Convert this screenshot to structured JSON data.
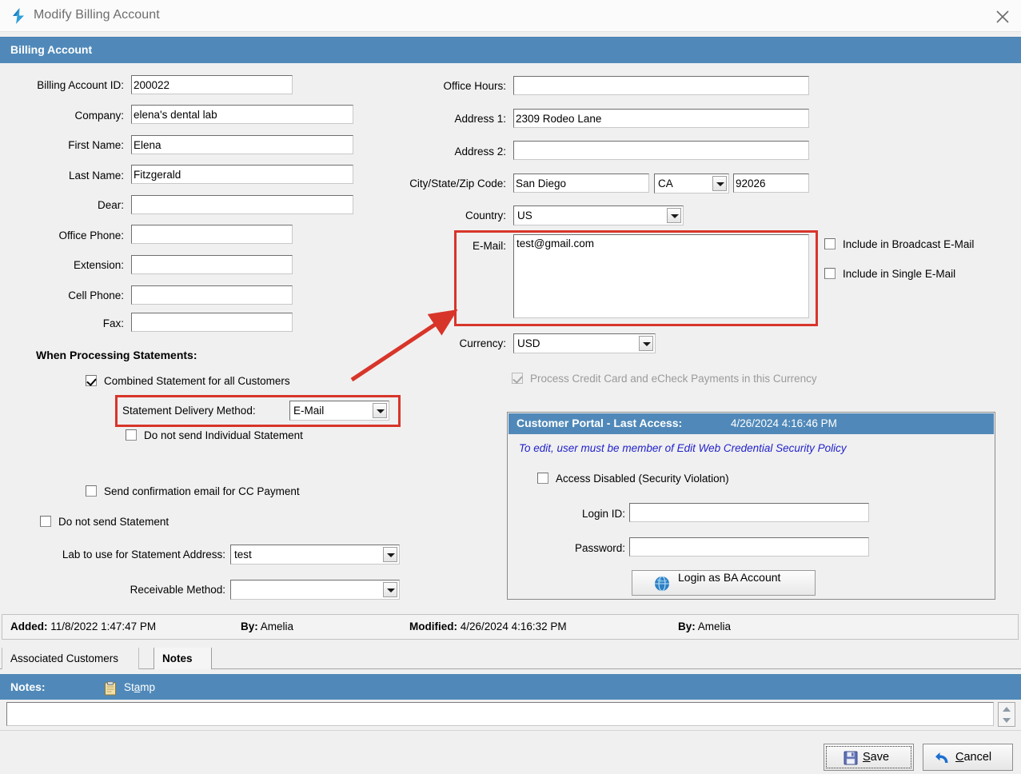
{
  "window": {
    "title": "Modify Billing Account",
    "logo_icon": "lightning-bolt-logo",
    "close_icon": "close-icon"
  },
  "section": {
    "header": "Billing Account"
  },
  "left_form": {
    "billing_account_id": {
      "label": "Billing Account ID:",
      "value": "200022"
    },
    "company": {
      "label": "Company:",
      "value": "elena's dental lab"
    },
    "first_name": {
      "label": "First Name:",
      "value": "Elena"
    },
    "last_name": {
      "label": "Last Name:",
      "value": "Fitzgerald"
    },
    "dear": {
      "label": "Dear:",
      "value": ""
    },
    "office_phone": {
      "label": "Office Phone:",
      "value": ""
    },
    "extension": {
      "label": "Extension:",
      "value": ""
    },
    "cell_phone": {
      "label": "Cell Phone:",
      "value": ""
    },
    "fax": {
      "label": "Fax:",
      "value": ""
    }
  },
  "right_form": {
    "office_hours": {
      "label": "Office Hours:",
      "value": ""
    },
    "address1": {
      "label": "Address 1:",
      "value": "2309 Rodeo Lane"
    },
    "address2": {
      "label": "Address 2:",
      "value": ""
    },
    "city_state_zip": {
      "label": "City/State/Zip Code:",
      "city": "San Diego",
      "state": "CA",
      "zip": "92026"
    },
    "country": {
      "label": "Country:",
      "value": "US"
    },
    "email": {
      "label": "E-Mail:",
      "value": "test@gmail.com"
    },
    "include_broadcast": {
      "label": "Include in Broadcast E-Mail",
      "checked": false
    },
    "include_single": {
      "label": "Include in Single E-Mail",
      "checked": false
    },
    "currency": {
      "label": "Currency:",
      "value": "USD"
    },
    "process_cc": {
      "label": "Process Credit Card and eCheck Payments in this Currency",
      "checked": true,
      "disabled": true
    }
  },
  "statements": {
    "heading": "When Processing Statements:",
    "combined_statement": {
      "label": "Combined Statement for all Customers",
      "checked": true
    },
    "delivery_method": {
      "label": "Statement Delivery Method:",
      "value": "E-Mail"
    },
    "do_not_send_individual": {
      "label": "Do not send Individual Statement",
      "checked": false
    },
    "send_confirmation_cc": {
      "label": "Send confirmation email for CC Payment",
      "checked": false
    },
    "do_not_send_statement": {
      "label": "Do not send Statement",
      "checked": false
    },
    "lab_statement_address": {
      "label": "Lab to use for Statement Address:",
      "value": "test"
    },
    "receivable_method": {
      "label": "Receivable Method:",
      "value": ""
    }
  },
  "portal": {
    "title": "Customer Portal - Last Access:",
    "last_access": "4/26/2024 4:16:46 PM",
    "note": "To edit, user must be member of Edit Web Credential Security Policy",
    "access_disabled": {
      "label": "Access Disabled (Security Violation)",
      "checked": false
    },
    "login_id": {
      "label": "Login ID:",
      "value": ""
    },
    "password": {
      "label": "Password:",
      "value": ""
    },
    "login_button": {
      "label": "Login as BA Account",
      "icon": "globe-icon"
    }
  },
  "meta": {
    "added_label": "Added:",
    "added_value": "11/8/2022 1:47:47 PM",
    "added_by_label": "By:",
    "added_by_value": "Amelia",
    "modified_label": "Modified:",
    "modified_value": "4/26/2024 4:16:32 PM",
    "modified_by_label": "By:",
    "modified_by_value": "Amelia"
  },
  "tabs": [
    {
      "label": "Associated Customers",
      "active": false
    },
    {
      "label": "Notes",
      "active": true
    }
  ],
  "notes": {
    "label": "Notes:",
    "stamp_label": "Stamp",
    "stamp_icon": "clipboard-icon",
    "value": ""
  },
  "footer": {
    "save": {
      "label": "Save",
      "icon": "floppy-disk-icon"
    },
    "cancel": {
      "label": "Cancel",
      "icon": "undo-arrow-icon"
    }
  },
  "annotations": {
    "highlight_color": "#d8352a",
    "boxes": [
      "email-field-highlight",
      "statement-delivery-method-highlight"
    ],
    "arrow": "red-arrow-delivery-to-email"
  },
  "colors": {
    "header_blue": "#5089b9",
    "note_blue": "#2222cc",
    "annotation_red": "#d8352a"
  }
}
